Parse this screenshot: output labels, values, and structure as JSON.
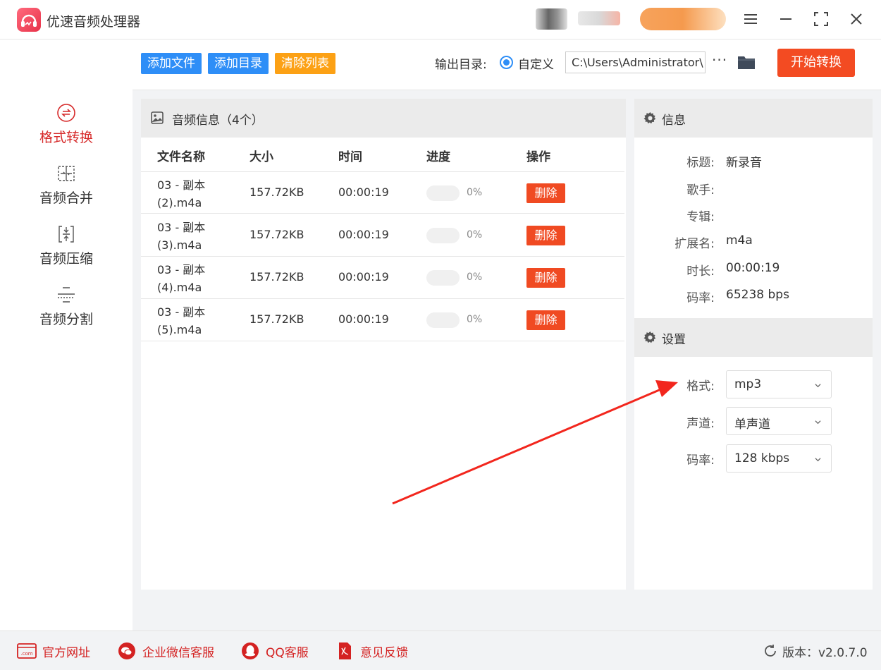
{
  "app": {
    "title": "优速音频处理器"
  },
  "sidebar": {
    "items": [
      {
        "label": "格式转换",
        "icon": "format-convert-icon",
        "active": true
      },
      {
        "label": "音频合并",
        "icon": "merge-icon",
        "active": false
      },
      {
        "label": "音频压缩",
        "icon": "compress-icon",
        "active": false
      },
      {
        "label": "音频分割",
        "icon": "split-icon",
        "active": false
      }
    ]
  },
  "toolbar": {
    "add_file": "添加文件",
    "add_dir": "添加目录",
    "clear_list": "清除列表",
    "output_label": "输出目录:",
    "custom_label": "自定义",
    "output_path": "C:\\Users\\Administrator\\",
    "more": "···",
    "start": "开始转换"
  },
  "file_panel": {
    "title": "音频信息（4个）",
    "columns": [
      "文件名称",
      "大小",
      "时间",
      "进度",
      "操作"
    ],
    "rows": [
      {
        "name": "03 - 副本 (2).m4a",
        "size": "157.72KB",
        "time": "00:00:19",
        "progress": 0,
        "progress_text": "0%",
        "action": "删除"
      },
      {
        "name": "03 - 副本 (3).m4a",
        "size": "157.72KB",
        "time": "00:00:19",
        "progress": 0,
        "progress_text": "0%",
        "action": "删除"
      },
      {
        "name": "03 - 副本 (4).m4a",
        "size": "157.72KB",
        "time": "00:00:19",
        "progress": 0,
        "progress_text": "0%",
        "action": "删除"
      },
      {
        "name": "03 - 副本 (5).m4a",
        "size": "157.72KB",
        "time": "00:00:19",
        "progress": 0,
        "progress_text": "0%",
        "action": "删除"
      }
    ]
  },
  "info": {
    "title": "信息",
    "fields": [
      {
        "label": "标题:",
        "value": "新录音"
      },
      {
        "label": "歌手:",
        "value": ""
      },
      {
        "label": "专辑:",
        "value": ""
      },
      {
        "label": "扩展名:",
        "value": "m4a"
      },
      {
        "label": "时长:",
        "value": "00:00:19"
      },
      {
        "label": "码率:",
        "value": "65238 bps"
      }
    ]
  },
  "settings": {
    "title": "设置",
    "format": {
      "label": "格式:",
      "value": "mp3"
    },
    "channel": {
      "label": "声道:",
      "value": "单声道"
    },
    "bitrate": {
      "label": "码率:",
      "value": "128 kbps"
    }
  },
  "footer": {
    "website": "官方网址",
    "wechat": "企业微信客服",
    "qq": "QQ客服",
    "feedback": "意见反馈",
    "version": "版本：v2.0.7.0"
  },
  "colors": {
    "accent": "#2e8ef7",
    "danger": "#f04a22",
    "orange": "#fca115",
    "active_red": "#d62929"
  }
}
